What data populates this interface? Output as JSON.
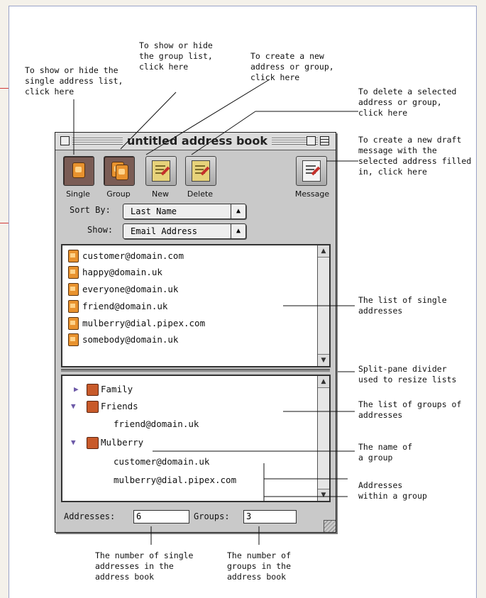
{
  "window": {
    "title": "untitled address book"
  },
  "toolbar": {
    "single_label": "Single",
    "group_label": "Group",
    "new_label": "New",
    "delete_label": "Delete",
    "message_label": "Message"
  },
  "sort": {
    "label": "Sort By:",
    "value": "Last Name"
  },
  "show": {
    "label": "Show:",
    "value": "Email Address"
  },
  "single_addresses": [
    "customer@domain.com",
    "happy@domain.uk",
    "everyone@domain.uk",
    "friend@domain.uk",
    "mulberry@dial.pipex.com",
    "somebody@domain.uk"
  ],
  "groups": {
    "family": "Family",
    "friends": "Friends",
    "friends_member_1": "friend@domain.uk",
    "mulberry": "Mulberry",
    "mulberry_member_1": "customer@domain.uk",
    "mulberry_member_2": "mulberry@dial.pipex.com"
  },
  "footer": {
    "addresses_label": "Addresses:",
    "addresses_value": "6",
    "groups_label": "Groups:",
    "groups_value": "3"
  },
  "annotations": {
    "single_toggle": "To show or hide the\nsingle address list,\nclick here",
    "group_toggle": "To show or hide\nthe group list,\nclick here",
    "create_new": "To create a new\naddress or group,\nclick here",
    "delete_selected": "To delete a selected\naddress or group,\nclick here",
    "create_draft": "To create a new draft\nmessage with the\nselected address filled\nin, click here",
    "single_list": "The list of single\naddresses",
    "divider": "Split-pane divider\nused to resize lists",
    "group_list": "The list of groups of\naddresses",
    "group_name": "The name of\na group",
    "group_addresses": "Addresses\nwithin a group",
    "single_count": "The number of single\naddresses in the\naddress book",
    "group_count": "The number of\ngroups in the\naddress book"
  }
}
